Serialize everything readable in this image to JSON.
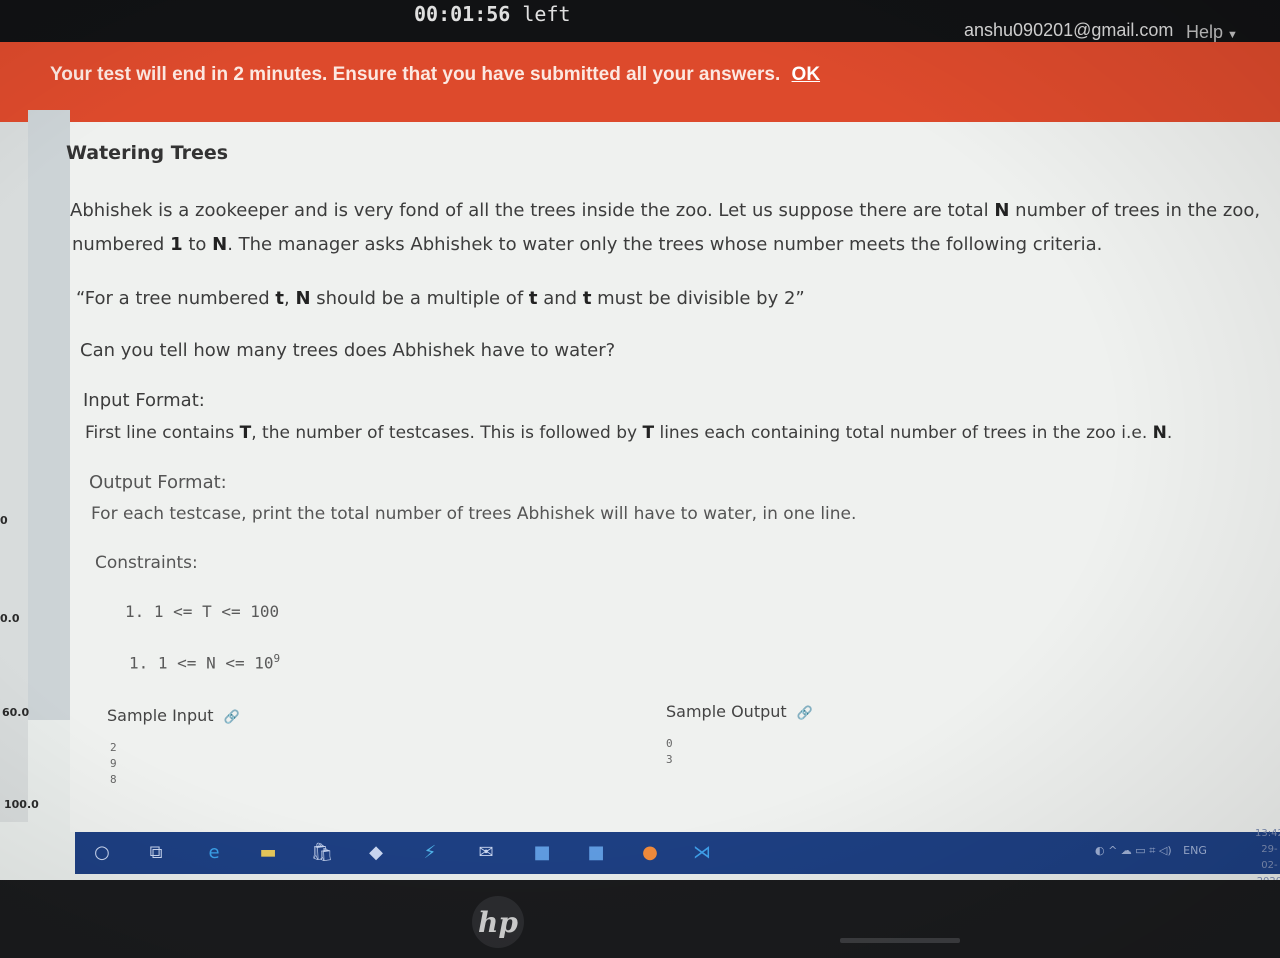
{
  "timer": {
    "value": "00:01:56",
    "suffix": "left"
  },
  "user": {
    "email": "anshu090201@gmail.com",
    "help_label": "Help"
  },
  "banner": {
    "message": "Your test will end in 2 minutes. Ensure that you have submitted all your answers.",
    "ok_label": "OK"
  },
  "side_axis": [
    "0",
    "0.0",
    "60.0",
    "100.0"
  ],
  "problem": {
    "title": "Watering Trees",
    "statement_line1_pre": "Abhishek is a zookeeper and is very fond of all the trees inside the zoo. Let us suppose there are total ",
    "statement_line1_var": "N",
    "statement_line1_post": " number of trees in the zoo,",
    "statement_line2_pre": "numbered ",
    "statement_line2_one": "1",
    "statement_line2_mid": " to ",
    "statement_line2_var": "N",
    "statement_line2_post": ". The manager asks Abhishek to water only the trees whose number meets the following criteria.",
    "criteria_a": "“For a tree numbered ",
    "criteria_t1": "t",
    "criteria_b": ", ",
    "criteria_n": "N",
    "criteria_c": " should be a multiple of ",
    "criteria_t2": "t",
    "criteria_d": " and ",
    "criteria_t3": "t",
    "criteria_e": " must be divisible by 2”",
    "question": "Can you tell how many trees does Abhishek have to water?",
    "input_heading": "Input Format:",
    "input_pre": "First line contains ",
    "input_t": "T",
    "input_mid": ", the number of testcases. This is followed by ",
    "input_t2": "T",
    "input_post": " lines each containing total number of trees in the zoo i.e. ",
    "input_n": "N",
    "input_end": ".",
    "output_heading": "Output Format:",
    "output_text": "For each testcase, print the total number of trees Abhishek will have to water, in one line.",
    "constraints_heading": "Constraints:",
    "constraint1": "1. 1 <= T <= 100",
    "constraint2_pre": "1. 1 <= N <= 10",
    "constraint2_exp": "9",
    "sample_input_label": "Sample Input",
    "sample_output_label": "Sample Output",
    "sample_input": [
      "2",
      "9",
      "8"
    ],
    "sample_output": [
      "0",
      "3"
    ]
  },
  "taskbar": {
    "tray_lang": "ENG",
    "time": "13:42",
    "date": "29-02-2020"
  }
}
